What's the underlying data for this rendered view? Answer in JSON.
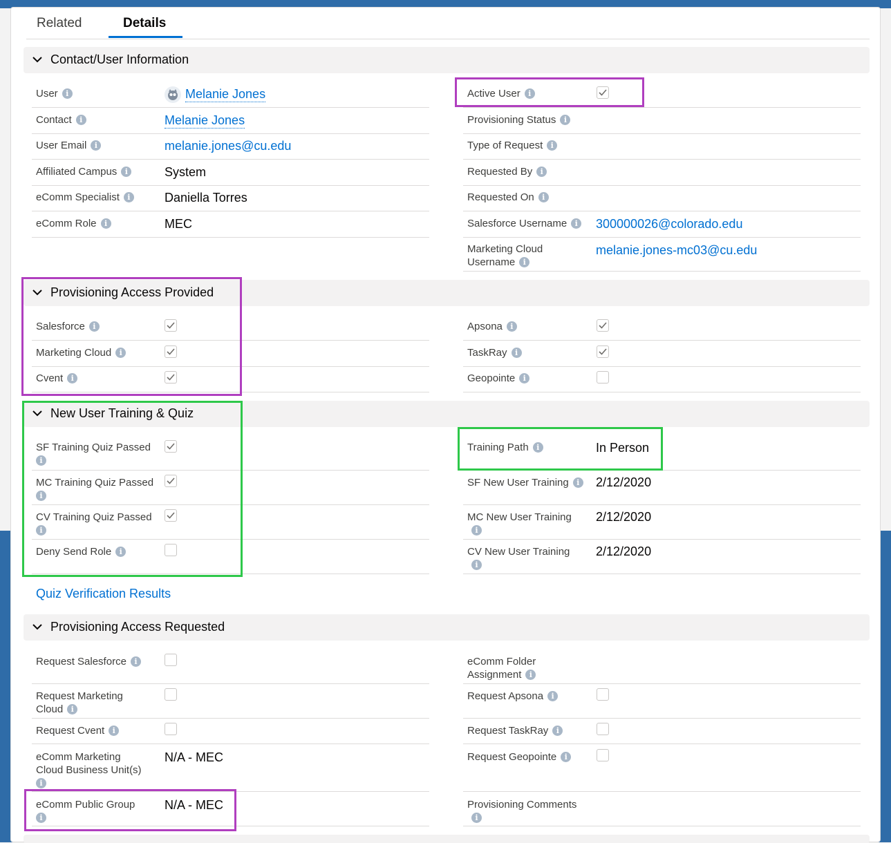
{
  "tabs": {
    "related": "Related",
    "details": "Details"
  },
  "sections": {
    "contact_user_info": "Contact/User Information",
    "provisioning_access_provided": "Provisioning Access Provided",
    "new_user_training": "New User Training & Quiz",
    "provisioning_access_requested": "Provisioning Access Requested"
  },
  "contact_user_info": {
    "user_label": "User",
    "user_value": "Melanie Jones",
    "contact_label": "Contact",
    "contact_value": "Melanie Jones",
    "email_label": "User Email",
    "email_value": "melanie.jones@cu.edu",
    "campus_label": "Affiliated Campus",
    "campus_value": "System",
    "specialist_label": "eComm Specialist",
    "specialist_value": "Daniella Torres",
    "role_label": "eComm Role",
    "role_value": "MEC",
    "active_user_label": "Active User",
    "active_user_checked": true,
    "prov_status_label": "Provisioning Status",
    "type_request_label": "Type of Request",
    "requested_by_label": "Requested By",
    "requested_on_label": "Requested On",
    "sf_username_label": "Salesforce Username",
    "sf_username_value": "300000026@colorado.edu",
    "mc_username_label_1": "Marketing Cloud",
    "mc_username_label_2": "Username",
    "mc_username_value": "melanie.jones-mc03@cu.edu"
  },
  "provided": {
    "salesforce": "Salesforce",
    "marketing_cloud": "Marketing Cloud",
    "cvent": "Cvent",
    "apsona": "Apsona",
    "taskray": "TaskRay",
    "geopointe": "Geopointe",
    "checked": {
      "salesforce": true,
      "marketing_cloud": true,
      "cvent": true,
      "apsona": true,
      "taskray": true,
      "geopointe": false
    }
  },
  "training": {
    "sf_quiz": "SF Training Quiz Passed",
    "mc_quiz": "MC Training Quiz Passed",
    "cv_quiz": "CV Training Quiz Passed",
    "deny_send": "Deny Send Role",
    "training_path_label": "Training Path",
    "training_path_value": "In Person",
    "sf_new_label": "SF New User Training",
    "sf_new_value": "2/12/2020",
    "mc_new_label": "MC New User Training",
    "mc_new_value": "2/12/2020",
    "cv_new_label": "CV New User Training",
    "cv_new_value": "2/12/2020",
    "quiz_link": "Quiz Verification Results"
  },
  "requested": {
    "req_sf": "Request Salesforce",
    "req_mc_1": "Request Marketing",
    "req_mc_2": "Cloud",
    "req_cvent": "Request Cvent",
    "bu_1": "eComm Marketing",
    "bu_2": "Cloud Business Unit(s)",
    "bu_value": "N/A - MEC",
    "public_group": "eComm Public Group",
    "public_group_value": "N/A - MEC",
    "folder_1": "eComm Folder",
    "folder_2": "Assignment",
    "req_apsona": "Request Apsona",
    "req_taskray": "Request TaskRay",
    "req_geopointe": "Request Geopointe",
    "prov_comments": "Provisioning Comments"
  },
  "icons": {
    "info": "i"
  },
  "colors": {
    "link": "#0070d2",
    "highlight_purple": "#b03fbf",
    "highlight_green": "#2ec84a"
  }
}
